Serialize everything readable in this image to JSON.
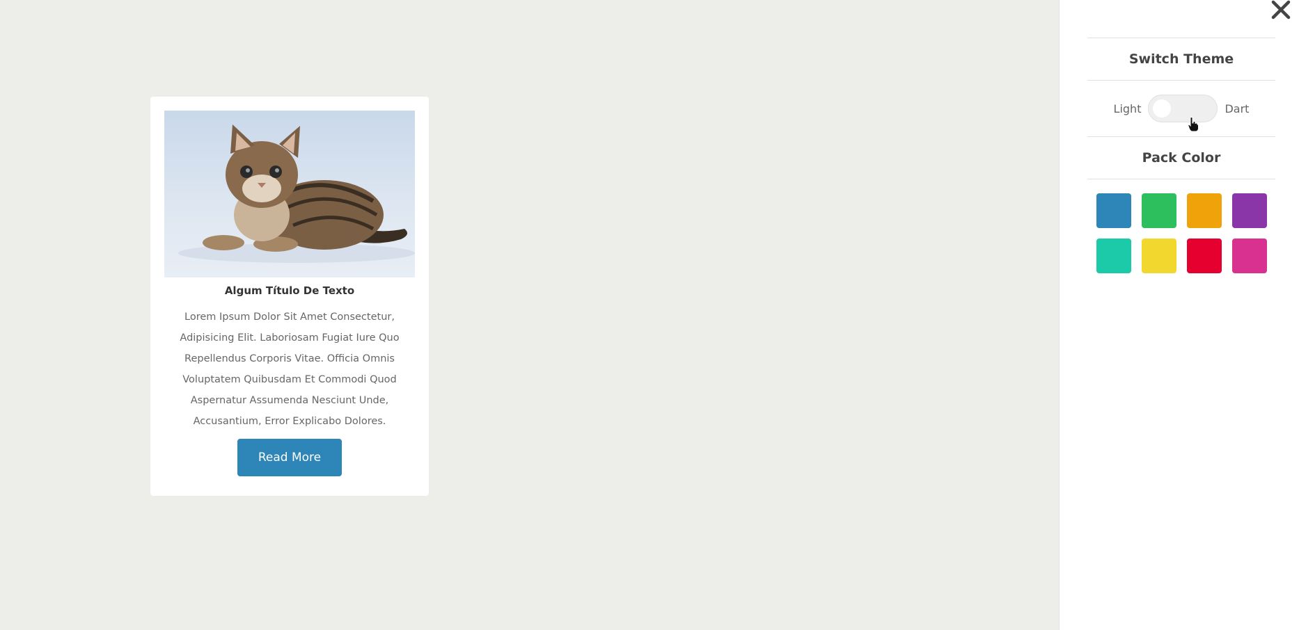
{
  "card": {
    "image_alt": "kitten photo",
    "title": "Algum Título De Texto",
    "text": "Lorem Ipsum Dolor Sit Amet Consectetur, Adipisicing Elit. Laboriosam Fugiat Iure Quo Repellendus Corporis Vitae. Officia Omnis Voluptatem Quibusdam Et Commodi Quod Aspernatur Assumenda Nesciunt Unde, Accusantium, Error Explicabo Dolores.",
    "button_label": "Read More",
    "button_color": "#2e85b8"
  },
  "panel": {
    "close_icon": "close-icon",
    "switch_theme": {
      "title": "Switch Theme",
      "light_label": "Light",
      "dark_label": "Dart",
      "is_dark": false
    },
    "pack_color": {
      "title": "Pack Color",
      "colors": [
        "#2e85b8",
        "#2dbf5e",
        "#f0a20a",
        "#8a36a9",
        "#1cc9a8",
        "#f2d82e",
        "#e5002f",
        "#d93190"
      ]
    }
  }
}
